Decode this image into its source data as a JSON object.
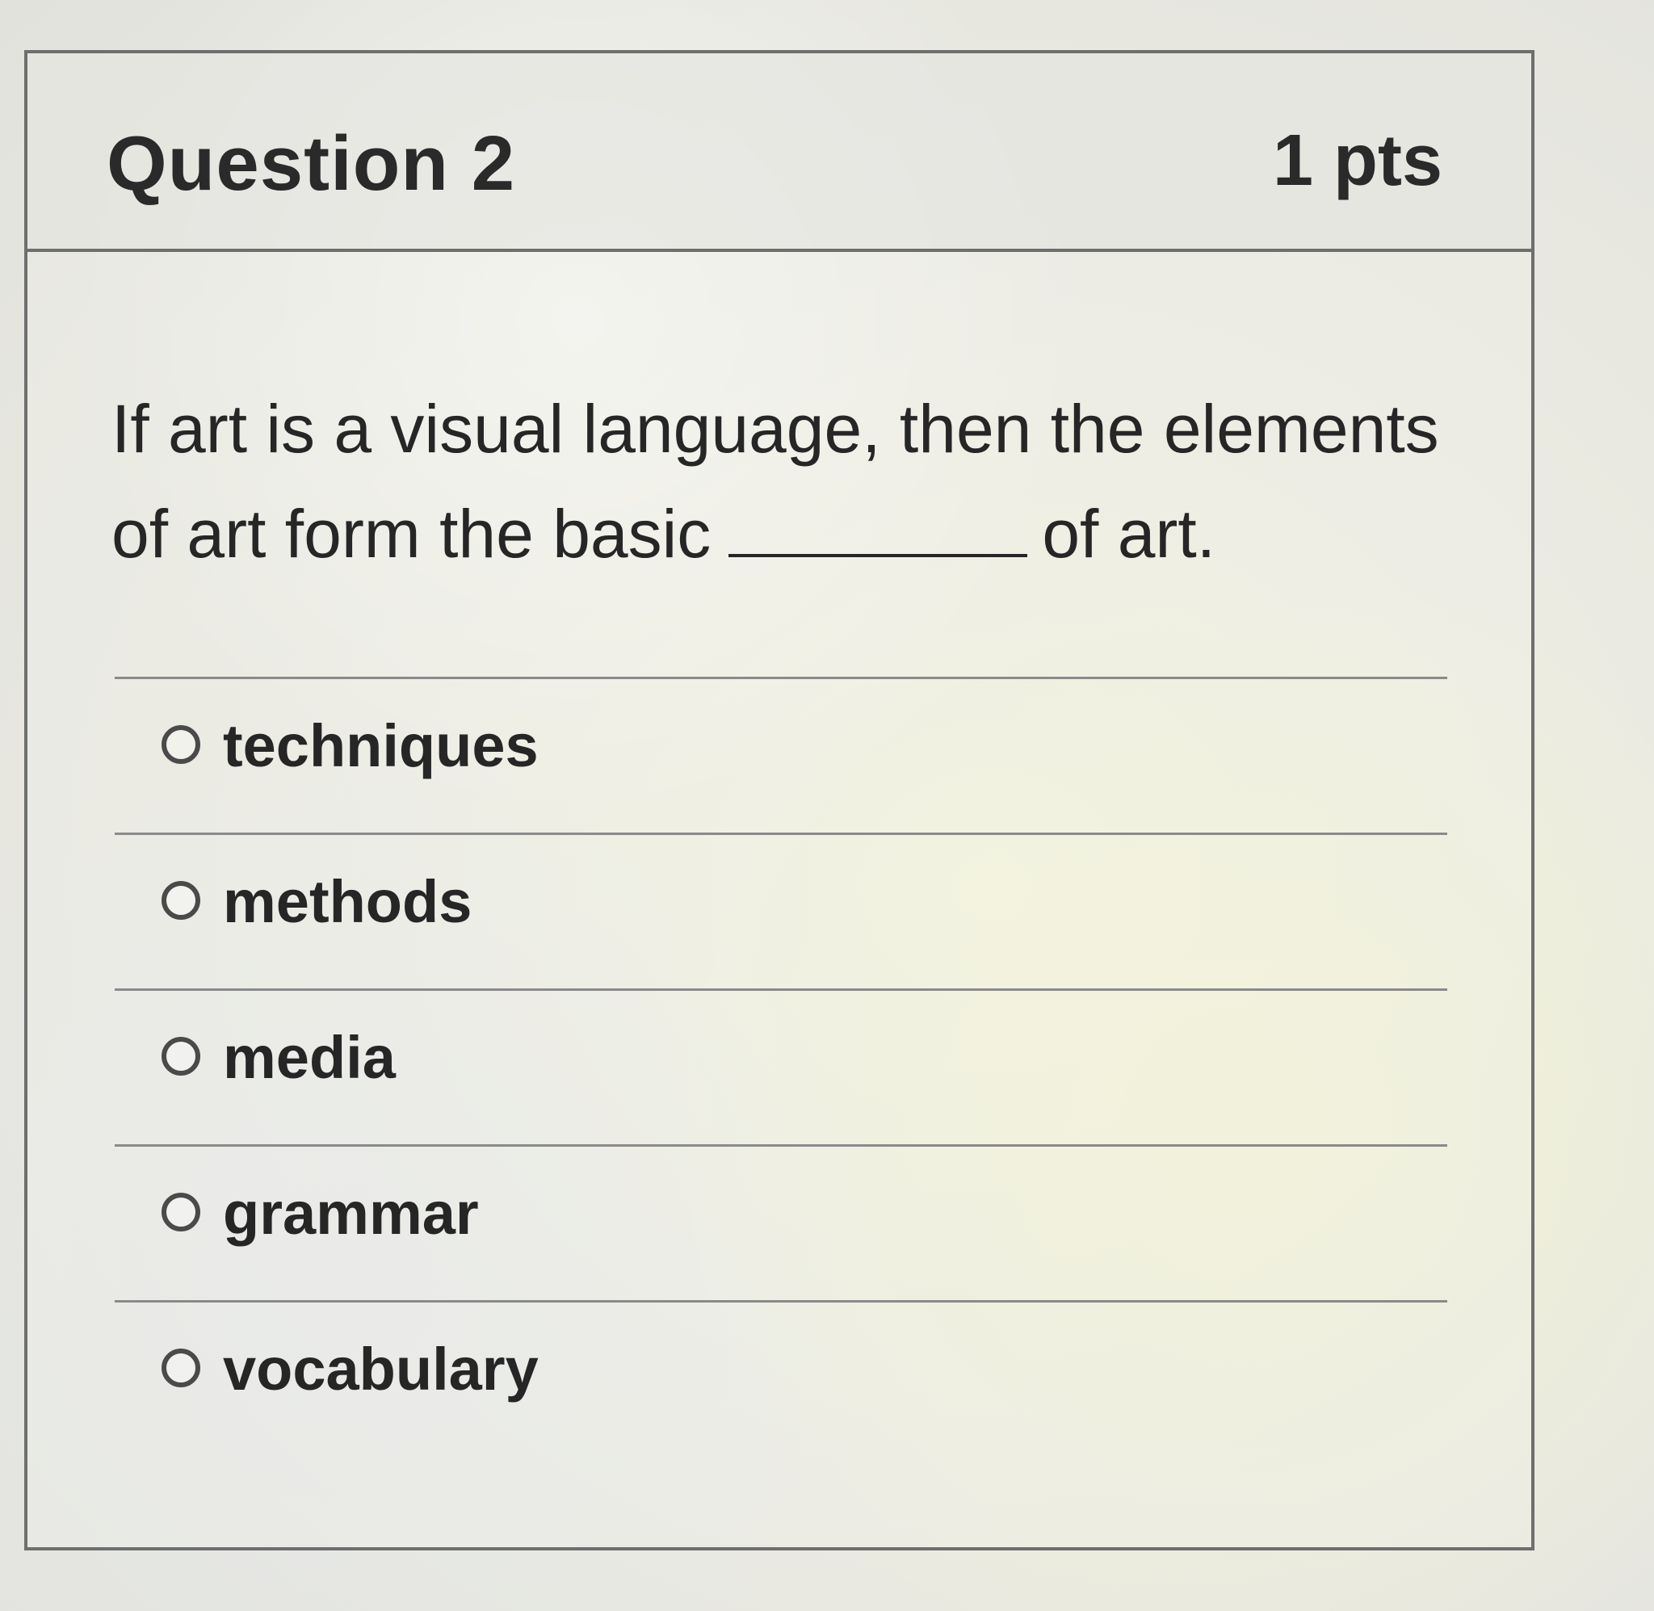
{
  "question": {
    "title": "Question 2",
    "points": "1 pts",
    "text_before_blank": "If art is a visual language, then the elements of art form the basic",
    "text_after_blank": "of art."
  },
  "answers": [
    {
      "label": "techniques"
    },
    {
      "label": "methods"
    },
    {
      "label": "media"
    },
    {
      "label": "grammar"
    },
    {
      "label": "vocabulary"
    }
  ]
}
